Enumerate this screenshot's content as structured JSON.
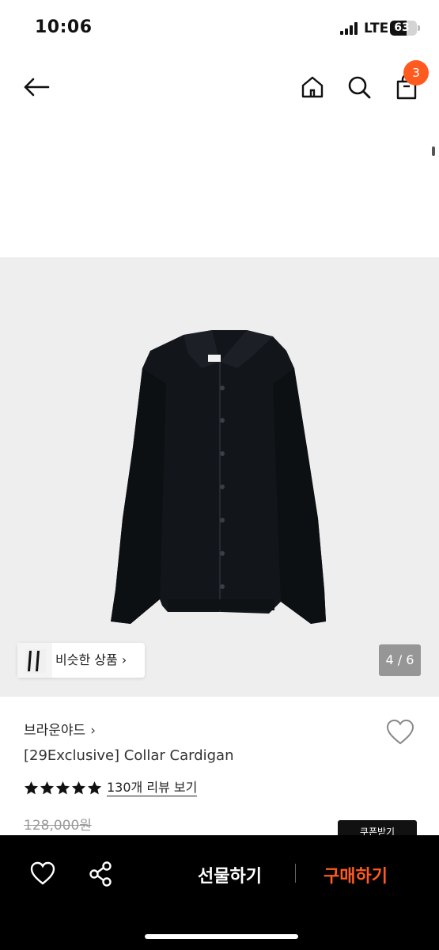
{
  "status_bar": {
    "time": "10:06",
    "network": "LTE",
    "battery": "63"
  },
  "nav": {
    "back_icon": "arrow-left-icon",
    "home_icon": "home-icon",
    "search_icon": "search-icon",
    "cart_icon": "shopping-bag-icon",
    "cart_count": "3"
  },
  "gallery": {
    "similar_label": "비슷한 상품 ›",
    "page_counter": "4 / 6",
    "current_page": 4,
    "total_pages": 6,
    "background_color": "#eeeeee"
  },
  "product": {
    "brand": "브라운야드",
    "title": "[29Exclusive] Collar Cardigan",
    "rating_stars": 5,
    "review_link": "130개 리뷰 보기",
    "original_price": "128,000원",
    "coupon_label": "쿠폰받기"
  },
  "bottom_bar": {
    "wish_icon": "heart-outline-icon",
    "share_icon": "share-icon",
    "gift_label": "선물하기",
    "buy_label": "구매하기",
    "accent_color": "#ff5a1f"
  }
}
